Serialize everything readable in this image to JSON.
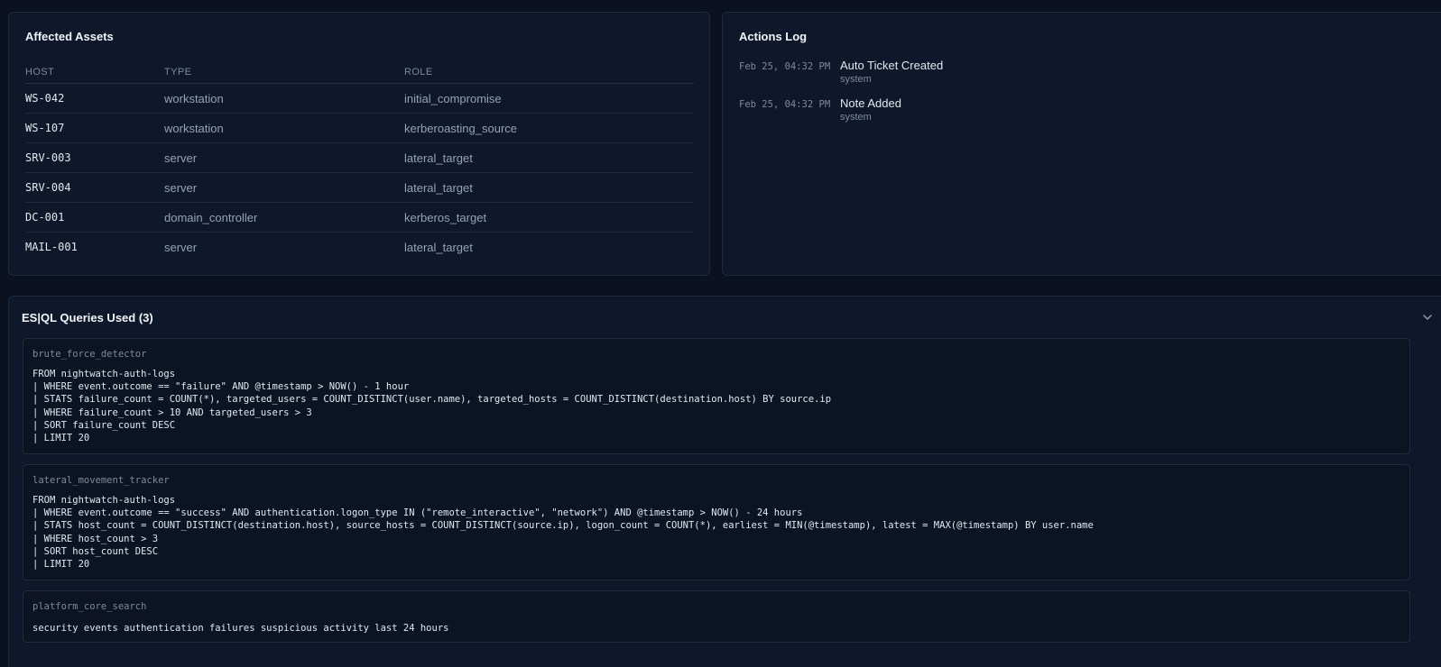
{
  "affected_assets": {
    "title": "Affected Assets",
    "columns": [
      "HOST",
      "TYPE",
      "ROLE"
    ],
    "rows": [
      {
        "host": "WS-042",
        "type": "workstation",
        "role": "initial_compromise"
      },
      {
        "host": "WS-107",
        "type": "workstation",
        "role": "kerberoasting_source"
      },
      {
        "host": "SRV-003",
        "type": "server",
        "role": "lateral_target"
      },
      {
        "host": "SRV-004",
        "type": "server",
        "role": "lateral_target"
      },
      {
        "host": "DC-001",
        "type": "domain_controller",
        "role": "kerberos_target"
      },
      {
        "host": "MAIL-001",
        "type": "server",
        "role": "lateral_target"
      }
    ]
  },
  "actions_log": {
    "title": "Actions Log",
    "entries": [
      {
        "time": "Feb 25, 04:32 PM",
        "title": "Auto Ticket Created",
        "user": "system"
      },
      {
        "time": "Feb 25, 04:32 PM",
        "title": "Note Added",
        "user": "system"
      }
    ]
  },
  "queries": {
    "title": "ES|QL Queries Used (3)",
    "toggle_icon": "chevron-down-icon",
    "items": [
      {
        "name": "brute_force_detector",
        "lines": [
          "FROM nightwatch-auth-logs",
          "| WHERE event.outcome == \"failure\" AND @timestamp > NOW() - 1 hour",
          "| STATS failure_count = COUNT(*), targeted_users = COUNT_DISTINCT(user.name), targeted_hosts = COUNT_DISTINCT(destination.host) BY source.ip",
          "| WHERE failure_count > 10 AND targeted_users > 3",
          "| SORT failure_count DESC",
          "| LIMIT 20"
        ]
      },
      {
        "name": "lateral_movement_tracker",
        "lines": [
          "FROM nightwatch-auth-logs",
          "| WHERE event.outcome == \"success\" AND authentication.logon_type IN (\"remote_interactive\", \"network\") AND @timestamp > NOW() - 24 hours",
          "| STATS host_count = COUNT_DISTINCT(destination.host), source_hosts = COUNT_DISTINCT(source.ip), logon_count = COUNT(*), earliest = MIN(@timestamp), latest = MAX(@timestamp) BY user.name",
          "| WHERE host_count > 3",
          "| SORT host_count DESC",
          "| LIMIT 20"
        ]
      },
      {
        "name": "platform_core_search",
        "lines": [
          "security events authentication failures suspicious activity last 24 hours"
        ]
      }
    ]
  }
}
